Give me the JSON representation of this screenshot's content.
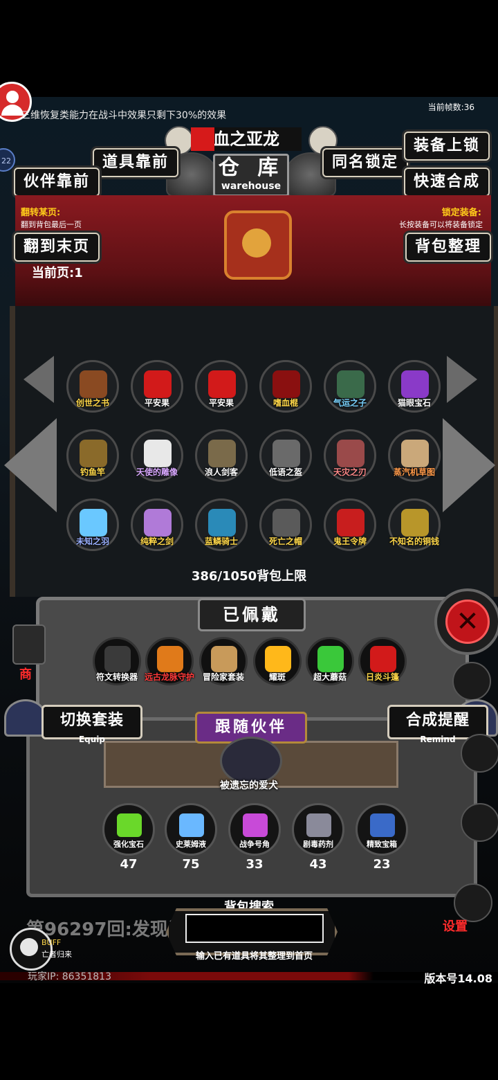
{
  "hud": {
    "notice": "三维恢复类能力在战斗中效果只剩下30%的效果",
    "fps_label": "当前帧数:36",
    "mini_tag": "22"
  },
  "header": {
    "owner_name": "血之亚龙",
    "title_cn": "仓 库",
    "title_en": "warehouse"
  },
  "buttons": {
    "partner_front": "伙伴靠前",
    "items_front": "道具靠前",
    "same_name_lock": "同名锁定",
    "equip_lock": "装备上锁",
    "quick_merge": "快速合成",
    "go_last_page": "翻到末页",
    "sort_bag": "背包整理"
  },
  "notes": {
    "left_title": "翻转某页:",
    "left_sub": "翻到背包最后一页",
    "right_title": "锁定装备:",
    "right_sub": "长按装备可以将装备锁定"
  },
  "page": {
    "current": "当前页:1"
  },
  "inventory": {
    "items": [
      {
        "label": "创世之书",
        "color": "#ffd84a",
        "icon": "#8a4a22"
      },
      {
        "label": "平安果",
        "color": "#ffffff",
        "icon": "#d21a1a"
      },
      {
        "label": "平安果",
        "color": "#ffffff",
        "icon": "#d21a1a"
      },
      {
        "label": "嗜血棍",
        "color": "#ffd84a",
        "icon": "#8a1010"
      },
      {
        "label": "气运之子",
        "color": "#7ad3ff",
        "icon": "#3a6a4a"
      },
      {
        "label": "猫眼宝石",
        "color": "#ffffff",
        "icon": "#8a3ac8"
      },
      {
        "label": "钓鱼竿",
        "color": "#ffd84a",
        "icon": "#8a6a2a"
      },
      {
        "label": "天使的雕像",
        "color": "#d8a8ff",
        "icon": "#e8e8e8"
      },
      {
        "label": "浪人剑客",
        "color": "#ffffff",
        "icon": "#7a6a4a"
      },
      {
        "label": "低语之盔",
        "color": "#ffffff",
        "icon": "#6a6a6a"
      },
      {
        "label": "天灾之刃",
        "color": "#ff8a8a",
        "icon": "#9a4a4a"
      },
      {
        "label": "蒸汽机草图",
        "color": "#ff9a4a",
        "icon": "#caa87a"
      },
      {
        "label": "未知之羽",
        "color": "#9ab0ff",
        "icon": "#6ac8ff"
      },
      {
        "label": "纯粹之剑",
        "color": "#ffd84a",
        "icon": "#b07ad8"
      },
      {
        "label": "蓝鳞骑士",
        "color": "#ffd84a",
        "icon": "#2a8ab8"
      },
      {
        "label": "死亡之帽",
        "color": "#ffd84a",
        "icon": "#5a5a5a"
      },
      {
        "label": "鬼王令牌",
        "color": "#ffd84a",
        "icon": "#c81e1e"
      },
      {
        "label": "不知名的铜钱",
        "color": "#ffd84a",
        "icon": "#b8962a"
      }
    ],
    "capacity": "386/1050背包上限"
  },
  "worn": {
    "title": "已佩戴",
    "items": [
      {
        "label": "符文转换器",
        "color": "#ffffff",
        "icon": "#3a3a3a"
      },
      {
        "label": "远古龙脉守护",
        "color": "#ff3a3a",
        "icon": "#e07a1a"
      },
      {
        "label": "冒险家套装",
        "color": "#ffffff",
        "icon": "#c89a5a"
      },
      {
        "label": "耀斑",
        "color": "#ffffff",
        "icon": "#ffb81a"
      },
      {
        "label": "超大蘑菇",
        "color": "#ffffff",
        "icon": "#3ac83a"
      },
      {
        "label": "日炎斗篷",
        "color": "#ffd84a",
        "icon": "#d21a1a"
      }
    ]
  },
  "partner": {
    "switch_set": "切换套装",
    "switch_set_en": "Equip",
    "merge_remind": "合成提醒",
    "merge_remind_en": "Remind",
    "title": "跟随伙伴",
    "pet_name": "被遗忘的爱犬"
  },
  "consumables": [
    {
      "label": "强化宝石",
      "count": "47",
      "icon": "#6ad82a"
    },
    {
      "label": "史莱姆液",
      "count": "75",
      "icon": "#6ab8ff"
    },
    {
      "label": "战争号角",
      "count": "33",
      "icon": "#c84ad8"
    },
    {
      "label": "剧毒药剂",
      "count": "43",
      "icon": "#8a8a9a"
    },
    {
      "label": "精致宝箱",
      "count": "23",
      "icon": "#3a6ac8"
    }
  ],
  "bottom": {
    "log": "第96297回:发现试",
    "search_title": "背包搜索",
    "search_value": "",
    "search_hint": "输入已有道具将其整理到首页",
    "buff": "BUFF",
    "buff_name": "亡者归来",
    "player_ip": "玩家IP: 86351813",
    "version": "版本号14.08",
    "settings": "设置",
    "shop": "商"
  }
}
